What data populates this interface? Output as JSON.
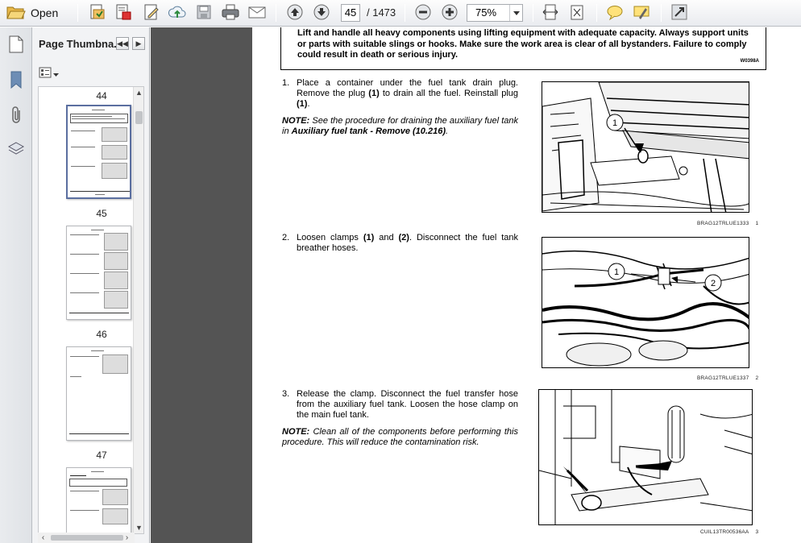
{
  "toolbar": {
    "open_label": "Open",
    "page_current": "45",
    "page_total": "/ 1473",
    "zoom_value": "75%",
    "icons": [
      "folder-open-icon",
      "save-as-icon",
      "pdf-create-icon",
      "edit-icon",
      "upload-icon",
      "save-icon",
      "print-icon",
      "email-icon",
      "page-up-icon",
      "page-down-icon",
      "zoom-out-icon",
      "zoom-in-icon",
      "fit-width-icon",
      "fit-page-icon",
      "comment-icon",
      "highlight-icon",
      "expand-icon"
    ]
  },
  "rail": {
    "icons": [
      "pages-icon",
      "bookmark-icon",
      "attachment-icon",
      "layers-icon"
    ]
  },
  "thumbnails": {
    "title": "Page Thumbna...",
    "options_icon": "thumbnail-options-icon",
    "pages": [
      {
        "number": "44"
      },
      {
        "number": "45"
      },
      {
        "number": "46"
      },
      {
        "number": "47"
      }
    ]
  },
  "document": {
    "warning_text": "Lift and handle all heavy components using lifting equipment with adequate capacity. Always support units or parts with suitable slings or hooks. Make sure the work area is clear of all bystanders. Failure to comply could result in death or serious injury.",
    "warning_code": "W0398A",
    "steps": [
      {
        "num": "1.",
        "text_parts": [
          "Place a container under the fuel tank drain plug. Remove the plug ",
          "(1)",
          " to drain all the fuel. Reinstall plug ",
          "(1)",
          "."
        ],
        "note_label": "NOTE:",
        "note_text": " See the procedure for draining the auxiliary fuel tank in ",
        "note_ref": "Auxiliary fuel tank - Remove (10.216)",
        "note_end": ".",
        "figure_caption": "BRAG12TRLUE1333",
        "figure_number": "1"
      },
      {
        "num": "2.",
        "text_parts": [
          "Loosen clamps ",
          "(1)",
          " and ",
          "(2)",
          ". Disconnect the fuel tank breather hoses."
        ],
        "figure_caption": "BRAG12TRLUE1337",
        "figure_number": "2"
      },
      {
        "num": "3.",
        "text_parts": [
          "Release the clamp. Disconnect the fuel transfer hose from the auxiliary fuel tank. Loosen the hose clamp on the main fuel tank."
        ],
        "note_label": "NOTE:",
        "note_text": " Clean all of the components before performing this procedure. This will reduce the contamination risk.",
        "figure_caption": "CUIL13TR00536AA",
        "figure_number": "3"
      }
    ],
    "callouts": [
      "1",
      "1",
      "2"
    ]
  }
}
